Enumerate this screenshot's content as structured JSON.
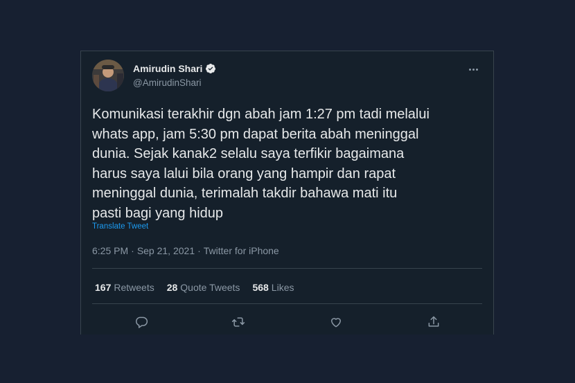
{
  "tweet": {
    "author": {
      "name": "Amirudin Shari",
      "handle": "@AmirudinShari",
      "verified": true
    },
    "text": "Komunikasi terakhir dgn abah jam 1:27 pm tadi melalui\nwhats app, jam 5:30 pm dapat berita abah meninggal\ndunia. Sejak kanak2 selalu saya terfikir bagaimana\nharus saya lalui bila orang yang hampir dan rapat\nmeninggal dunia, terimalah takdir bahawa mati  itu\npasti bagi yang hidup",
    "translate_label": "Translate Tweet",
    "time": "6:25 PM",
    "separator": "·",
    "date": "Sep 21, 2021",
    "source": "Twitter for iPhone",
    "stats": {
      "retweets": {
        "count": "167",
        "label": "Retweets"
      },
      "quote_tweets": {
        "count": "28",
        "label": "Quote Tweets"
      },
      "likes": {
        "count": "568",
        "label": "Likes"
      }
    },
    "actions": [
      "reply-icon",
      "retweet-icon",
      "like-icon",
      "share-icon"
    ]
  },
  "colors": {
    "background": "#172031",
    "card": "#15202b",
    "text": "#e7e9ea",
    "secondary": "#8b98a5",
    "accent": "#1d9bf0",
    "border": "#38444d"
  }
}
